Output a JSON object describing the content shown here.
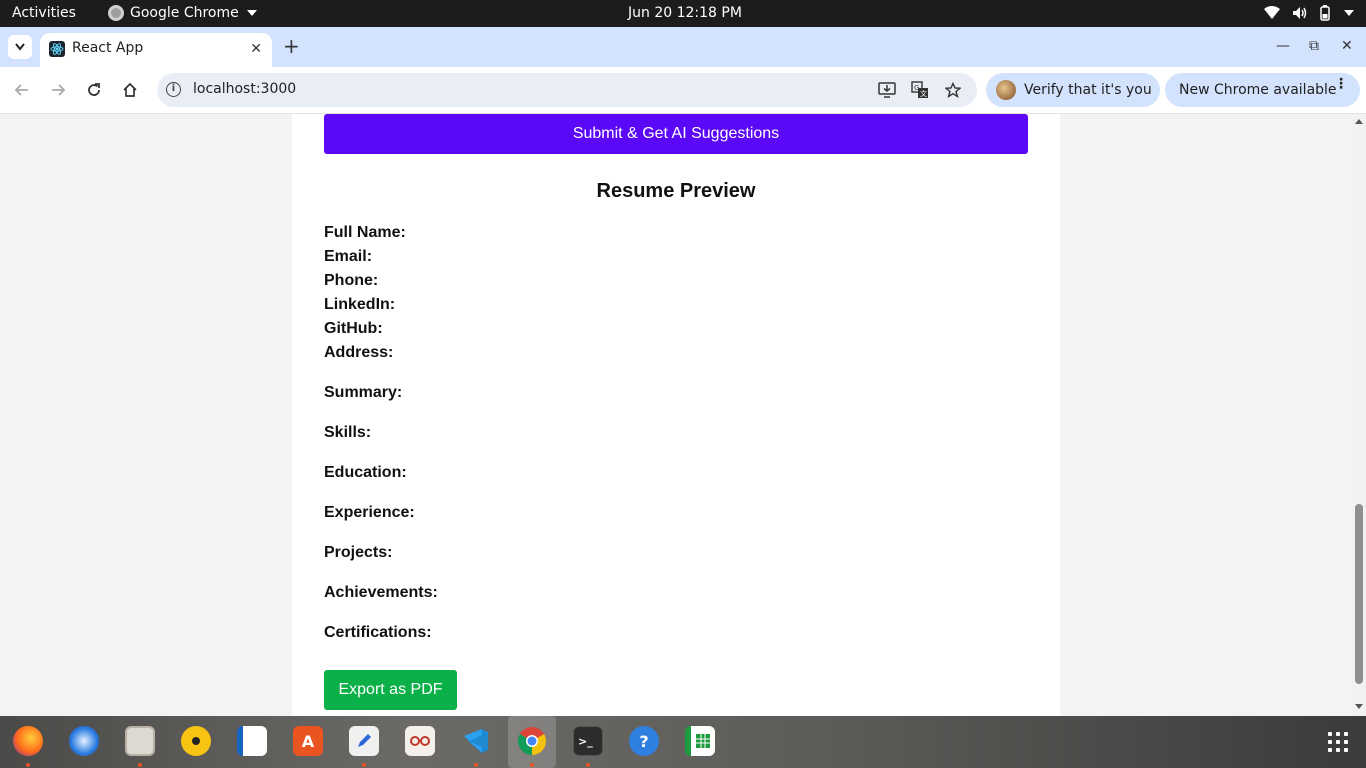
{
  "topbar": {
    "activities": "Activities",
    "app_name": "Google Chrome",
    "clock": "Jun 20  12:18 PM"
  },
  "browser": {
    "tab_title": "React App",
    "url": "localhost:3000",
    "verify_label": "Verify that it's you",
    "update_label": "New Chrome available"
  },
  "page": {
    "submit_label": "Submit & Get AI Suggestions",
    "preview_title": "Resume Preview",
    "fields": [
      "Full Name:",
      "Email:",
      "Phone:",
      "LinkedIn:",
      "GitHub:",
      "Address:",
      "Summary:",
      "Skills:",
      "Education:",
      "Experience:",
      "Projects:",
      "Achievements:",
      "Certifications:"
    ],
    "export_label": "Export as PDF"
  },
  "dock": {
    "apps": [
      "firefox-icon",
      "thunderbird-icon",
      "files-icon",
      "rhythmbox-icon",
      "writer-icon",
      "app-center-icon",
      "text-editor-icon",
      "document-viewer-icon",
      "vscode-icon",
      "chrome-icon",
      "terminal-icon",
      "help-icon",
      "calc-icon"
    ]
  },
  "colors": {
    "submit_button": "#5b08f8",
    "export_button": "#0cb048",
    "tabstrip": "#d3e3fd"
  }
}
